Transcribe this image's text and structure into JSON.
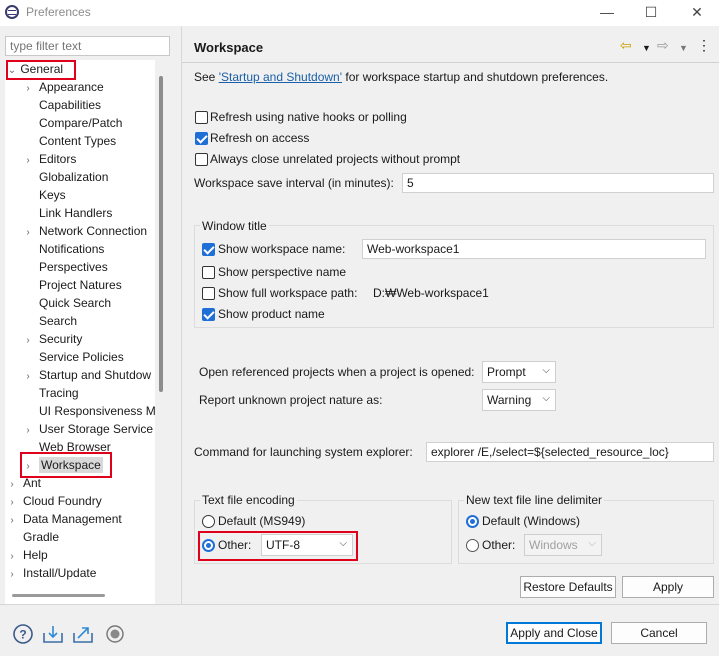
{
  "window": {
    "title": "Preferences",
    "minimize": "—",
    "maximize": "☐",
    "close": "✕"
  },
  "filter": {
    "placeholder": "type filter text"
  },
  "tree": {
    "general": "General",
    "general_children": [
      "Appearance",
      "Capabilities",
      "Compare/Patch",
      "Content Types",
      "Editors",
      "Globalization",
      "Keys",
      "Link Handlers",
      "Network Connection",
      "Notifications",
      "Perspectives",
      "Project Natures",
      "Quick Search",
      "Search",
      "Security",
      "Service Policies",
      "Startup and Shutdow",
      "Tracing",
      "UI Responsiveness M",
      "User Storage Service",
      "Web Browser",
      "Workspace"
    ],
    "top_level": [
      "Ant",
      "Cloud Foundry",
      "Data Management",
      "Gradle",
      "Help",
      "Install/Update"
    ]
  },
  "page": {
    "title": "Workspace",
    "see_prefix": "See ",
    "see_link": "'Startup and Shutdown'",
    "see_suffix": " for workspace startup and shutdown preferences.",
    "refresh_native": "Refresh using native hooks or polling",
    "refresh_access": "Refresh on access",
    "always_close": "Always close unrelated projects without prompt",
    "save_interval_label": "Workspace save interval (in minutes):",
    "save_interval_value": "5",
    "window_title_group": "Window title",
    "show_workspace_name": "Show workspace name:",
    "workspace_name_value": "Web-workspace1",
    "show_perspective_name": "Show perspective name",
    "show_full_path": "Show full workspace path:",
    "full_path_value": "D:₩Web-workspace1",
    "show_product_name": "Show product name",
    "open_referenced_label": "Open referenced projects when a project is opened:",
    "open_referenced_value": "Prompt",
    "report_unknown_label": "Report unknown project nature as:",
    "report_unknown_value": "Warning",
    "explorer_label": "Command for launching system explorer:",
    "explorer_value": "explorer /E,/select=${selected_resource_loc}",
    "encoding_group": "Text file encoding",
    "encoding_default": "Default (MS949)",
    "encoding_other": "Other:",
    "encoding_value": "UTF-8",
    "delimiter_group": "New text file line delimiter",
    "delimiter_default": "Default (Windows)",
    "delimiter_other": "Other:",
    "delimiter_value": "Windows",
    "restore_defaults": "Restore Defaults",
    "apply": "Apply"
  },
  "footer": {
    "apply_close": "Apply and Close",
    "cancel": "Cancel"
  },
  "colors": {
    "highlight": "#e0001b",
    "accent": "#1f6fd6",
    "link": "#1b5fa8"
  }
}
